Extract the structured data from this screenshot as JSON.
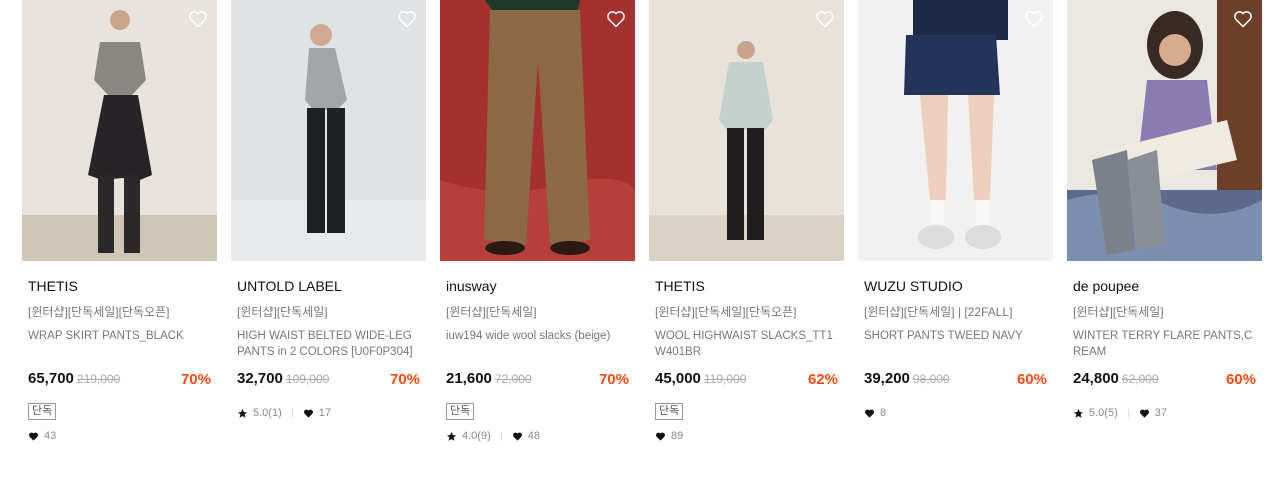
{
  "colors": {
    "discount": "#ff4a11",
    "text": "#111111",
    "muted": "#777777"
  },
  "products": [
    {
      "brand": "THETIS",
      "tags": "[윈터샵][단독세일][단독오픈]",
      "name": "WRAP SKIRT PANTS_BLACK",
      "price": "65,700",
      "original_price": "219,000",
      "discount": "70%",
      "badge": "단독",
      "rating": "",
      "likes": "43"
    },
    {
      "brand": "UNTOLD LABEL",
      "tags": "[윈터샵][단독세일]",
      "name": "HIGH WAIST BELTED WIDE-LEG PANTS in 2 COLORS [U0F0P304]",
      "price": "32,700",
      "original_price": "109,000",
      "discount": "70%",
      "badge": "",
      "rating": "5.0(1)",
      "likes": "17"
    },
    {
      "brand": "inusway",
      "tags": "[윈터샵][단독세일]",
      "name": "iuw194 wide wool slacks (beige)",
      "price": "21,600",
      "original_price": "72,000",
      "discount": "70%",
      "badge": "단독",
      "rating": "4.0(9)",
      "likes": "48"
    },
    {
      "brand": "THETIS",
      "tags": "[윈터샵][단독세일][단독오픈]",
      "name": "WOOL HIGHWAIST SLACKS_TT1W401BR",
      "price": "45,000",
      "original_price": "119,000",
      "discount": "62%",
      "badge": "단독",
      "rating": "",
      "likes": "89"
    },
    {
      "brand": "WUZU STUDIO",
      "tags": "[윈터샵][단독세일] | [22FALL]",
      "name": "SHORT PANTS TWEED NAVY",
      "price": "39,200",
      "original_price": "98,000",
      "discount": "60%",
      "badge": "",
      "rating": "",
      "likes": "8"
    },
    {
      "brand": "de poupee",
      "tags": "[윈터샵][단독세일]",
      "name": "WINTER TERRY FLARE PANTS,CREAM",
      "price": "24,800",
      "original_price": "62,000",
      "discount": "60%",
      "badge": "",
      "rating": "5.0(5)",
      "likes": "37"
    }
  ]
}
